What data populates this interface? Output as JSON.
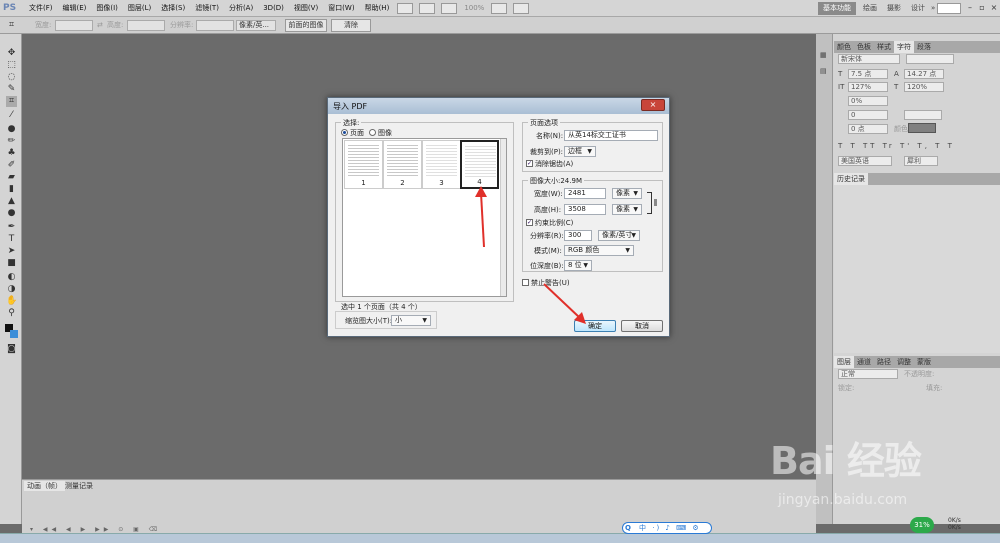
{
  "menubar": {
    "logo": "PS",
    "items": [
      "文件(F)",
      "编辑(E)",
      "图像(I)",
      "图层(L)",
      "选择(S)",
      "滤镜(T)",
      "分析(A)",
      "3D(D)",
      "视图(V)",
      "窗口(W)",
      "帮助(H)"
    ],
    "zoom": "100%",
    "workspaces": [
      "基本功能",
      "绘画",
      "摄影",
      "设计",
      "»"
    ]
  },
  "optbar": {
    "width_label": "宽度:",
    "height_label": "高度:",
    "resolution_label": "分辨率:",
    "units": "像素/英...",
    "front_image": "前面的图像",
    "clear": "清除"
  },
  "right_panel": {
    "tabs": [
      "颜色",
      "色板",
      "样式",
      "字符",
      "段落"
    ],
    "active_tab": "字符",
    "font_family": "新宋体",
    "font_size": "7.5 点",
    "leading": "14.27 点",
    "scale_v": "127%",
    "scale_h": "120%",
    "tracking": "0%",
    "kern": "0",
    "baseline": "0 点",
    "color_label": "颜色:",
    "language": "美国英语",
    "antialias": "犀利",
    "history_tab": "历史记录",
    "layers_tabs": [
      "图层",
      "通道",
      "路径",
      "调整",
      "蒙版"
    ],
    "blend_mode": "正常",
    "opacity_label": "不透明度:",
    "lock_label": "锁定:",
    "fill_label": "填充:"
  },
  "bottom_panel": {
    "tabs": [
      "动画（帧）",
      "测量记录"
    ]
  },
  "dialog": {
    "title": "导入 PDF",
    "close": "×",
    "select_group": "选择:",
    "radio_pages": "页面",
    "radio_images": "图像",
    "thumbnails": [
      "1",
      "2",
      "3",
      "4"
    ],
    "selected_page": "4",
    "selection_info": "选中 1 个页面（共 4 个）",
    "thumb_size_label": "缩览图大小(T):",
    "thumb_size_value": "小",
    "page_options_group": "页面选项",
    "name_label": "名称(N):",
    "name_value": "从英14标交工证书",
    "crop_label": "裁剪到(P):",
    "crop_value": "边框",
    "antialias_label": "消除锯齿(A)",
    "image_size_group": "图像大小:24.9M",
    "width_label": "宽度(W):",
    "width_value": "2481",
    "width_unit": "像素",
    "height_label": "高度(H):",
    "height_value": "3508",
    "height_unit": "像素",
    "constrain_label": "约束比例(C)",
    "resolution_label": "分辨率(R):",
    "resolution_value": "300",
    "resolution_unit": "像素/英寸",
    "mode_label": "模式(M):",
    "mode_value": "RGB 颜色",
    "depth_label": "位深度(B):",
    "depth_value": "8 位",
    "suppress_label": "禁止警告(U)",
    "ok": "确定",
    "cancel": "取消"
  },
  "tray": {
    "ime": "中 ·) ♪ ⌨ ⚙",
    "net_percent": "31%",
    "speed_up": "0K/s",
    "speed_down": "0K/s"
  },
  "watermark": {
    "logo": "Bai 经验",
    "url": "jingyan.baidu.com"
  },
  "colors": {
    "accent_red": "#e0302a",
    "dialog_ok": "#bee6fd",
    "workspace_bg": "#6b6b6b"
  }
}
